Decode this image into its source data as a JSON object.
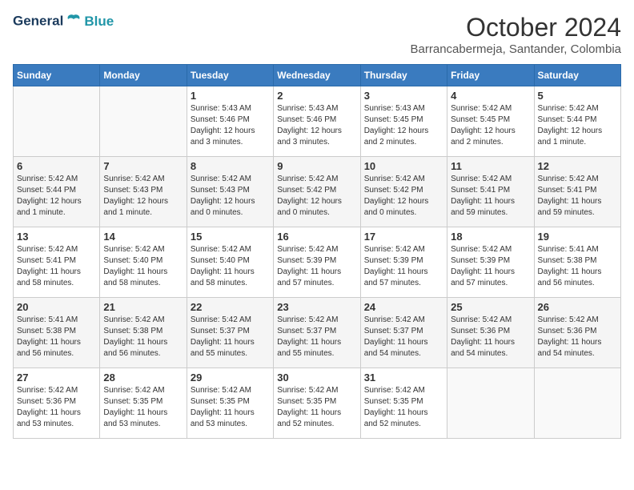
{
  "header": {
    "logo_line1": "General",
    "logo_line2": "Blue",
    "month_year": "October 2024",
    "location": "Barrancabermeja, Santander, Colombia"
  },
  "weekdays": [
    "Sunday",
    "Monday",
    "Tuesday",
    "Wednesday",
    "Thursday",
    "Friday",
    "Saturday"
  ],
  "weeks": [
    [
      {
        "day": "",
        "info": ""
      },
      {
        "day": "",
        "info": ""
      },
      {
        "day": "1",
        "info": "Sunrise: 5:43 AM\nSunset: 5:46 PM\nDaylight: 12 hours\nand 3 minutes."
      },
      {
        "day": "2",
        "info": "Sunrise: 5:43 AM\nSunset: 5:46 PM\nDaylight: 12 hours\nand 3 minutes."
      },
      {
        "day": "3",
        "info": "Sunrise: 5:43 AM\nSunset: 5:45 PM\nDaylight: 12 hours\nand 2 minutes."
      },
      {
        "day": "4",
        "info": "Sunrise: 5:42 AM\nSunset: 5:45 PM\nDaylight: 12 hours\nand 2 minutes."
      },
      {
        "day": "5",
        "info": "Sunrise: 5:42 AM\nSunset: 5:44 PM\nDaylight: 12 hours\nand 1 minute."
      }
    ],
    [
      {
        "day": "6",
        "info": "Sunrise: 5:42 AM\nSunset: 5:44 PM\nDaylight: 12 hours\nand 1 minute."
      },
      {
        "day": "7",
        "info": "Sunrise: 5:42 AM\nSunset: 5:43 PM\nDaylight: 12 hours\nand 1 minute."
      },
      {
        "day": "8",
        "info": "Sunrise: 5:42 AM\nSunset: 5:43 PM\nDaylight: 12 hours\nand 0 minutes."
      },
      {
        "day": "9",
        "info": "Sunrise: 5:42 AM\nSunset: 5:42 PM\nDaylight: 12 hours\nand 0 minutes."
      },
      {
        "day": "10",
        "info": "Sunrise: 5:42 AM\nSunset: 5:42 PM\nDaylight: 12 hours\nand 0 minutes."
      },
      {
        "day": "11",
        "info": "Sunrise: 5:42 AM\nSunset: 5:41 PM\nDaylight: 11 hours\nand 59 minutes."
      },
      {
        "day": "12",
        "info": "Sunrise: 5:42 AM\nSunset: 5:41 PM\nDaylight: 11 hours\nand 59 minutes."
      }
    ],
    [
      {
        "day": "13",
        "info": "Sunrise: 5:42 AM\nSunset: 5:41 PM\nDaylight: 11 hours\nand 58 minutes."
      },
      {
        "day": "14",
        "info": "Sunrise: 5:42 AM\nSunset: 5:40 PM\nDaylight: 11 hours\nand 58 minutes."
      },
      {
        "day": "15",
        "info": "Sunrise: 5:42 AM\nSunset: 5:40 PM\nDaylight: 11 hours\nand 58 minutes."
      },
      {
        "day": "16",
        "info": "Sunrise: 5:42 AM\nSunset: 5:39 PM\nDaylight: 11 hours\nand 57 minutes."
      },
      {
        "day": "17",
        "info": "Sunrise: 5:42 AM\nSunset: 5:39 PM\nDaylight: 11 hours\nand 57 minutes."
      },
      {
        "day": "18",
        "info": "Sunrise: 5:42 AM\nSunset: 5:39 PM\nDaylight: 11 hours\nand 57 minutes."
      },
      {
        "day": "19",
        "info": "Sunrise: 5:41 AM\nSunset: 5:38 PM\nDaylight: 11 hours\nand 56 minutes."
      }
    ],
    [
      {
        "day": "20",
        "info": "Sunrise: 5:41 AM\nSunset: 5:38 PM\nDaylight: 11 hours\nand 56 minutes."
      },
      {
        "day": "21",
        "info": "Sunrise: 5:42 AM\nSunset: 5:38 PM\nDaylight: 11 hours\nand 56 minutes."
      },
      {
        "day": "22",
        "info": "Sunrise: 5:42 AM\nSunset: 5:37 PM\nDaylight: 11 hours\nand 55 minutes."
      },
      {
        "day": "23",
        "info": "Sunrise: 5:42 AM\nSunset: 5:37 PM\nDaylight: 11 hours\nand 55 minutes."
      },
      {
        "day": "24",
        "info": "Sunrise: 5:42 AM\nSunset: 5:37 PM\nDaylight: 11 hours\nand 54 minutes."
      },
      {
        "day": "25",
        "info": "Sunrise: 5:42 AM\nSunset: 5:36 PM\nDaylight: 11 hours\nand 54 minutes."
      },
      {
        "day": "26",
        "info": "Sunrise: 5:42 AM\nSunset: 5:36 PM\nDaylight: 11 hours\nand 54 minutes."
      }
    ],
    [
      {
        "day": "27",
        "info": "Sunrise: 5:42 AM\nSunset: 5:36 PM\nDaylight: 11 hours\nand 53 minutes."
      },
      {
        "day": "28",
        "info": "Sunrise: 5:42 AM\nSunset: 5:35 PM\nDaylight: 11 hours\nand 53 minutes."
      },
      {
        "day": "29",
        "info": "Sunrise: 5:42 AM\nSunset: 5:35 PM\nDaylight: 11 hours\nand 53 minutes."
      },
      {
        "day": "30",
        "info": "Sunrise: 5:42 AM\nSunset: 5:35 PM\nDaylight: 11 hours\nand 52 minutes."
      },
      {
        "day": "31",
        "info": "Sunrise: 5:42 AM\nSunset: 5:35 PM\nDaylight: 11 hours\nand 52 minutes."
      },
      {
        "day": "",
        "info": ""
      },
      {
        "day": "",
        "info": ""
      }
    ]
  ]
}
